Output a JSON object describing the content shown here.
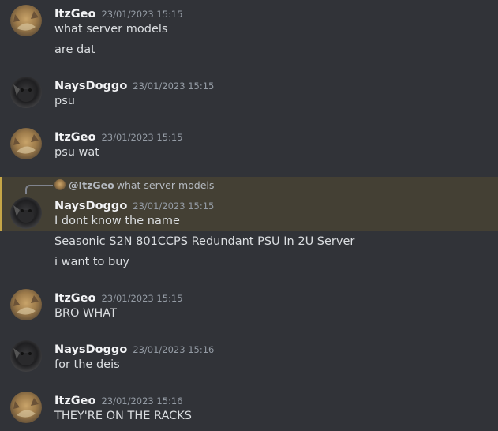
{
  "messages": [
    {
      "author": "ItzGeo",
      "timestamp": "23/01/2023 15:15",
      "lines": [
        "what server models",
        "are dat"
      ]
    },
    {
      "author": "NaysDoggo",
      "timestamp": "23/01/2023 15:15",
      "lines": [
        "psu"
      ]
    },
    {
      "author": "ItzGeo",
      "timestamp": "23/01/2023 15:15",
      "lines": [
        "psu wat"
      ]
    },
    {
      "author": "NaysDoggo",
      "timestamp": "23/01/2023 15:15",
      "lines": [
        "I dont know the name",
        "Seasonic S2N 801CCPS Redundant PSU In 2U Server",
        "i want to buy"
      ],
      "reply": {
        "mention": "@ItzGeo",
        "text": "what server models"
      }
    },
    {
      "author": "ItzGeo",
      "timestamp": "23/01/2023 15:15",
      "lines": [
        "BRO WHAT"
      ]
    },
    {
      "author": "NaysDoggo",
      "timestamp": "23/01/2023 15:16",
      "lines": [
        "for the deis"
      ]
    },
    {
      "author": "ItzGeo",
      "timestamp": "23/01/2023 15:16",
      "lines": [
        "THEY'RE ON THE RACKS"
      ]
    }
  ],
  "colors": {
    "background": "#313338",
    "mention_highlight": "#444034",
    "mention_bar": "#c6a647",
    "username": "#f2f3f5",
    "timestamp": "#949ba4"
  }
}
